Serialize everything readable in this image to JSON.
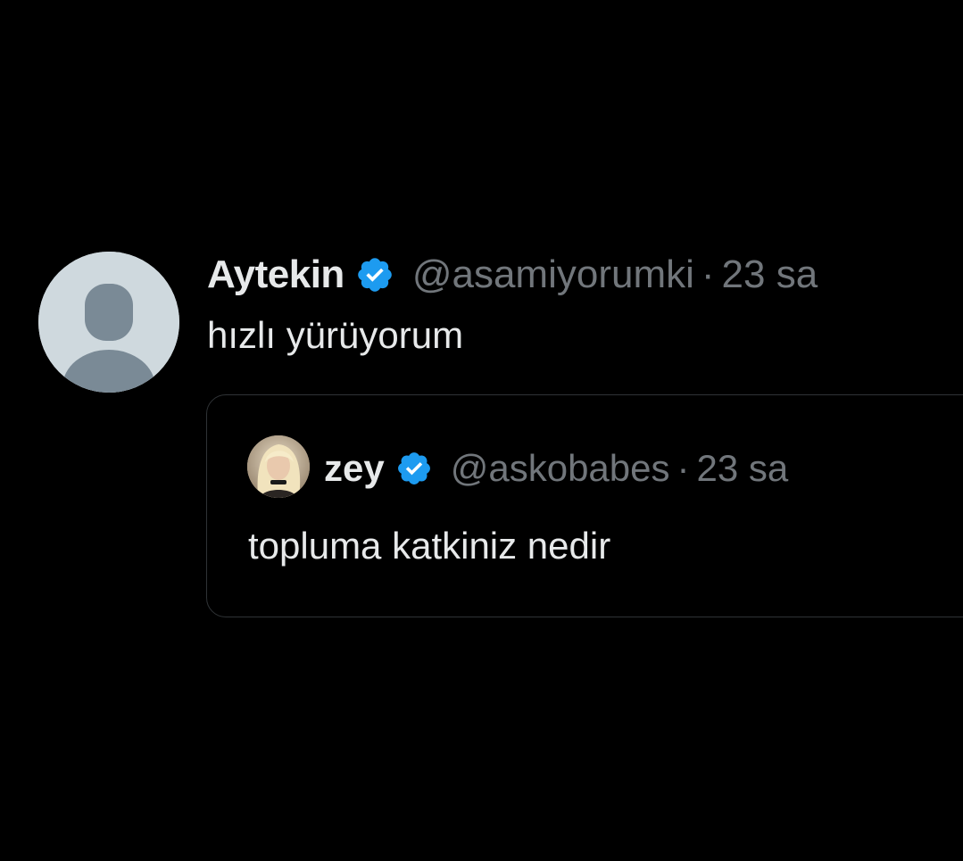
{
  "tweet": {
    "author_name": "Aytekin",
    "handle": "@asamiyorumki",
    "separator": "·",
    "time": "23 sa",
    "text": "hızlı yürüyorum",
    "verified_icon": "verified-badge-icon",
    "avatar_icon": "default-avatar-icon"
  },
  "quote": {
    "author_name": "zey",
    "handle": "@askobabes",
    "separator": "·",
    "time": "23 sa",
    "text": "topluma katkiniz nedir",
    "verified_icon": "verified-badge-icon"
  },
  "colors": {
    "background": "#000000",
    "primary_text": "#e7e9ea",
    "secondary_text": "#71767b",
    "verified_blue": "#1d9bf0",
    "card_border": "#2f3336",
    "default_avatar_bg": "#cfd9de",
    "default_avatar_fg": "#7a8a96"
  }
}
